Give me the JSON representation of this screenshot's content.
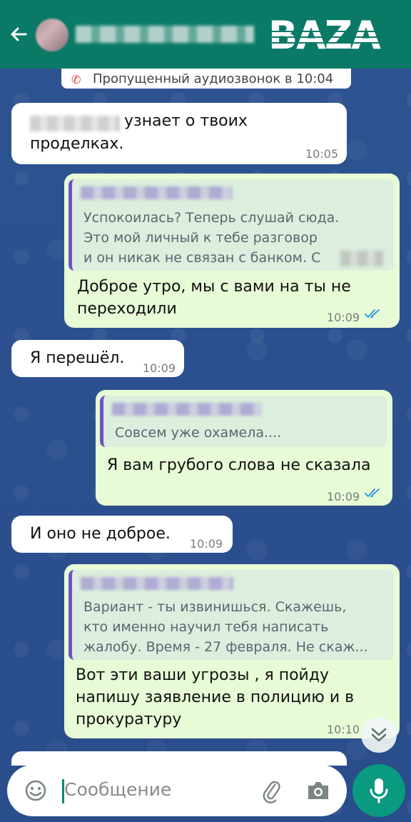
{
  "header": {
    "back_icon": "arrow-left-icon",
    "logo_text": "BAZA",
    "colors": {
      "header_bg": "#0a7a67"
    }
  },
  "system_message": {
    "text": "Пропущенный аудиозвонок в 10:04",
    "icon": "missed-call-icon"
  },
  "messages": [
    {
      "dir": "in",
      "text_line1": "узнает о твоих",
      "text_line2": "проделках.",
      "time": "10:05"
    },
    {
      "dir": "out",
      "quote_text": "Успокоилась? Теперь слушай сюда.\nЭто мой личный к тебе разговор\nи он никак не связан с банком. С",
      "text": "Доброе утро, мы с вами на ты не переходили",
      "time": "10:09"
    },
    {
      "dir": "in",
      "text": "Я перешёл.",
      "time": "10:09"
    },
    {
      "dir": "out",
      "quote_text": "Совсем уже охамела....",
      "text": "Я вам грубого слова не сказала",
      "time": "10:09"
    },
    {
      "dir": "in",
      "text": "И оно не доброе.",
      "time": "10:09"
    },
    {
      "dir": "out",
      "quote_text": "Вариант - ты извинишься. Скажешь,\nкто именно научил тебя написать\nжалобу. Время - 27 февраля. Не скаж...",
      "text": "Вот эти ваши угрозы , я пойду напишу заявление в полицию и в прокуратуру",
      "time": "10:10"
    }
  ],
  "composer": {
    "placeholder": "Сообщение",
    "emoji_icon": "emoji-icon",
    "attach_icon": "paperclip-icon",
    "camera_icon": "camera-icon",
    "mic_icon": "microphone-icon"
  },
  "scroll_icon": "chevrons-down-icon"
}
